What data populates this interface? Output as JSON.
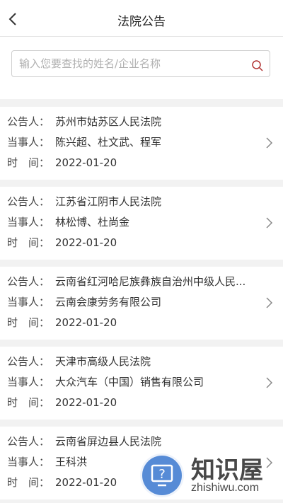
{
  "header": {
    "title": "法院公告"
  },
  "search": {
    "placeholder": "输入您要查找的姓名/企业名称",
    "value": ""
  },
  "labels": {
    "announcer": "公告人：",
    "party": "当事人：",
    "time": "时　间："
  },
  "notices": [
    {
      "announcer": "苏州市姑苏区人民法院",
      "party": "陈兴超、杜文武、程军",
      "time": "2022-01-20"
    },
    {
      "announcer": "江苏省江阴市人民法院",
      "party": "林松博、杜尚金",
      "time": "2022-01-20"
    },
    {
      "announcer": "云南省红河哈尼族彝族自治州中级人民...",
      "party": "云南会康劳务有限公司",
      "time": "2022-01-20"
    },
    {
      "announcer": "天津市高级人民法院",
      "party": "大众汽车（中国）销售有限公司",
      "time": "2022-01-20"
    },
    {
      "announcer": "云南省屏边县人民法院",
      "party": "王科洪",
      "time": "2022-01-20"
    }
  ],
  "watermark": {
    "brand": "知识屋",
    "domain": "zhishiwu.com"
  },
  "colors": {
    "accent": "#b03030",
    "watermark_blue": "#1e64c8"
  }
}
